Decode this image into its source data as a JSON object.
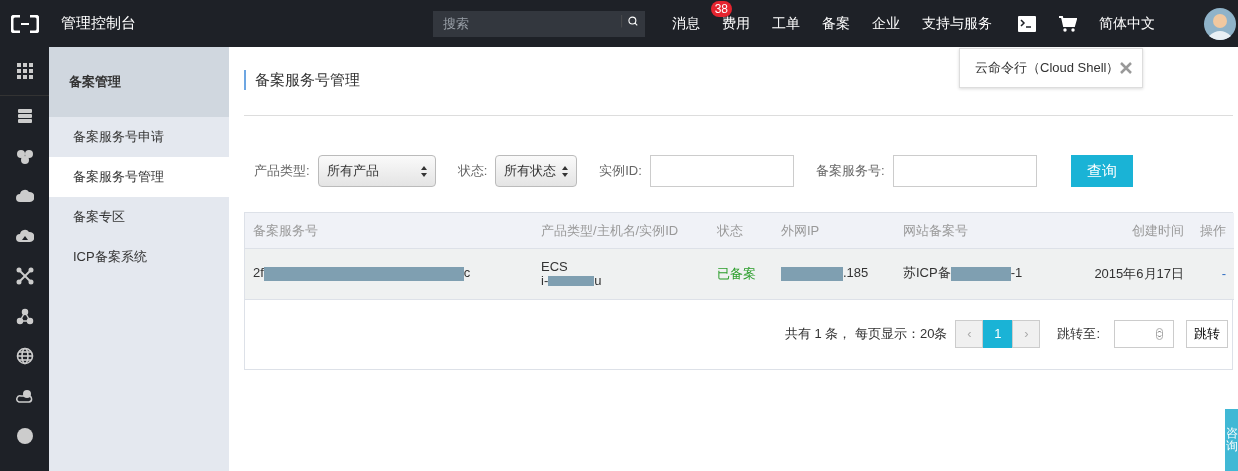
{
  "header": {
    "title": "管理控制台",
    "search": {
      "placeholder": "搜索"
    },
    "nav": [
      {
        "label": "消息",
        "badge": "38"
      },
      {
        "label": "费用"
      },
      {
        "label": "工单"
      },
      {
        "label": "备案"
      },
      {
        "label": "企业"
      },
      {
        "label": "支持与服务"
      }
    ],
    "language": "简体中文"
  },
  "tooltip": {
    "text": "云命令行（Cloud Shell）"
  },
  "sidebar": {
    "title": "备案管理",
    "items": [
      {
        "label": "备案服务号申请",
        "selected": false
      },
      {
        "label": "备案服务号管理",
        "selected": true
      },
      {
        "label": "备案专区",
        "selected": false
      },
      {
        "label": "ICP备案系统",
        "selected": false
      }
    ]
  },
  "page_title": "备案服务号管理",
  "filters": [
    {
      "kind": "select",
      "label": "产品类型:",
      "value": "所有产品"
    },
    {
      "kind": "select",
      "label": "状态:",
      "value": "所有状态"
    },
    {
      "kind": "input",
      "label": "实例ID:"
    },
    {
      "kind": "input",
      "label": "备案服务号:"
    }
  ],
  "query_button": "查询",
  "table": {
    "columns": [
      "备案服务号",
      "产品类型/主机名/实例ID",
      "状态",
      "外网IP",
      "网站备案号",
      "创建时间",
      "操作"
    ],
    "rows": [
      {
        "cells": [
          {
            "lines": [
              {
                "before": "2f",
                "redacted": true,
                "after": "c"
              }
            ]
          },
          {
            "lines": [
              {
                "before": "ECS"
              },
              {
                "before": "i-",
                "redacted": true,
                "after": "u"
              }
            ]
          },
          {
            "kind": "status",
            "lines": [
              {
                "before": "已备案"
              }
            ]
          },
          {
            "lines": [
              {
                "redacted": true,
                "after": ".185"
              }
            ]
          },
          {
            "lines": [
              {
                "before": "苏ICP备",
                "redacted": true,
                "after": "-1"
              }
            ]
          },
          {
            "lines": [
              {
                "before": "2015年6月17日"
              }
            ]
          },
          {
            "kind": "action",
            "lines": [
              {
                "before": "-"
              }
            ]
          }
        ]
      }
    ]
  },
  "pagination": {
    "summary": "共有 1 条， 每页显示：20条",
    "prev": "‹",
    "pages": [
      {
        "label": "1",
        "selected": true
      }
    ],
    "next": "›",
    "jump_label": "跳转至:",
    "jump_button": "跳转"
  },
  "consult_tab": "咨询"
}
